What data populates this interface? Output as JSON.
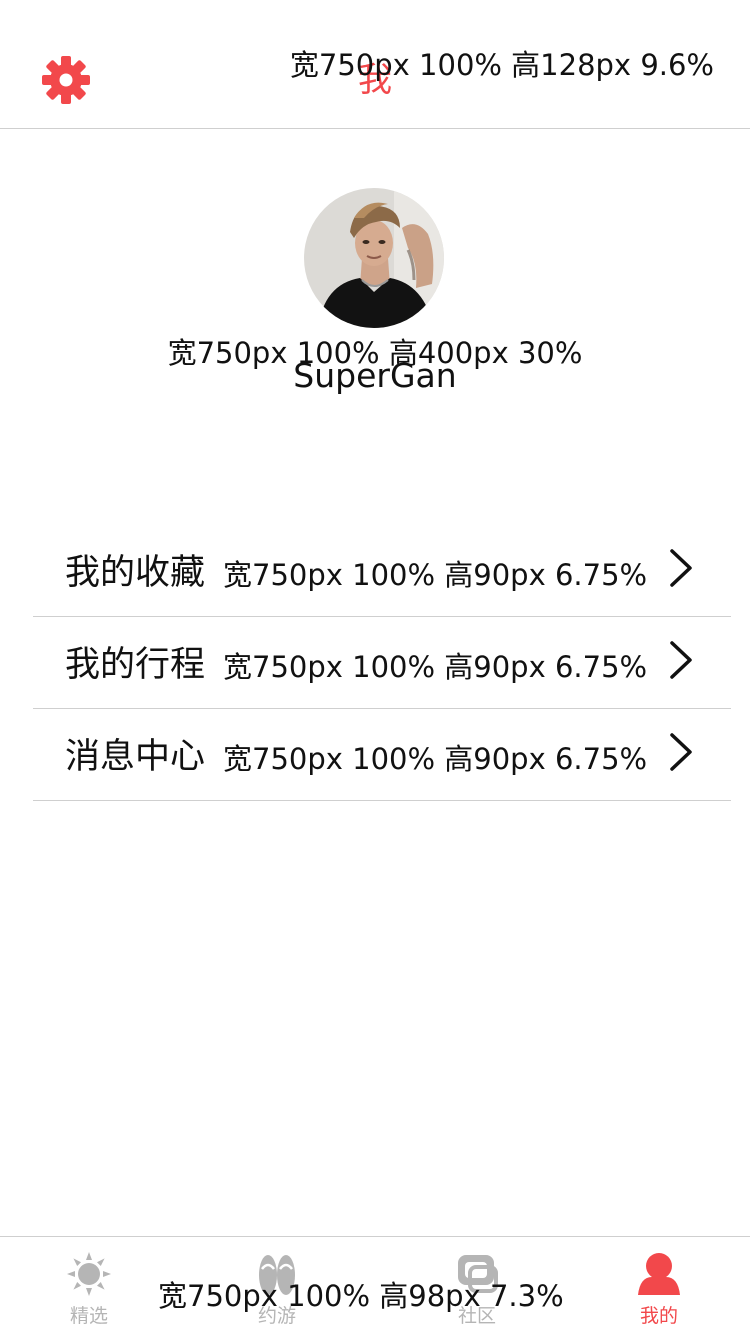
{
  "header": {
    "title": "我",
    "annotation": "宽750px 100% 高128px 9.6%",
    "settings_icon": "gear-icon",
    "accent_color": "#f2484b"
  },
  "profile": {
    "annotation": "宽750px 100% 高400px 30%",
    "username": "SuperGan",
    "avatar_icon": "avatar-photo"
  },
  "menu": {
    "items": [
      {
        "label": "我的收藏",
        "annotation": "宽750px 100% 高90px 6.75%"
      },
      {
        "label": "我的行程",
        "annotation": "宽750px 100% 高90px 6.75%"
      },
      {
        "label": "消息中心",
        "annotation": "宽750px 100% 高90px 6.75%"
      }
    ]
  },
  "tabbar": {
    "annotation": "宽750px 100% 高98px 7.3%",
    "tabs": [
      {
        "label": "精选",
        "icon": "sun-icon",
        "active": false
      },
      {
        "label": "约游",
        "icon": "flip-flops-icon",
        "active": false
      },
      {
        "label": "社区",
        "icon": "community-icon",
        "active": false
      },
      {
        "label": "我的",
        "icon": "person-icon",
        "active": true
      }
    ],
    "active_color": "#f2484b",
    "inactive_color": "#b5b5b5"
  }
}
